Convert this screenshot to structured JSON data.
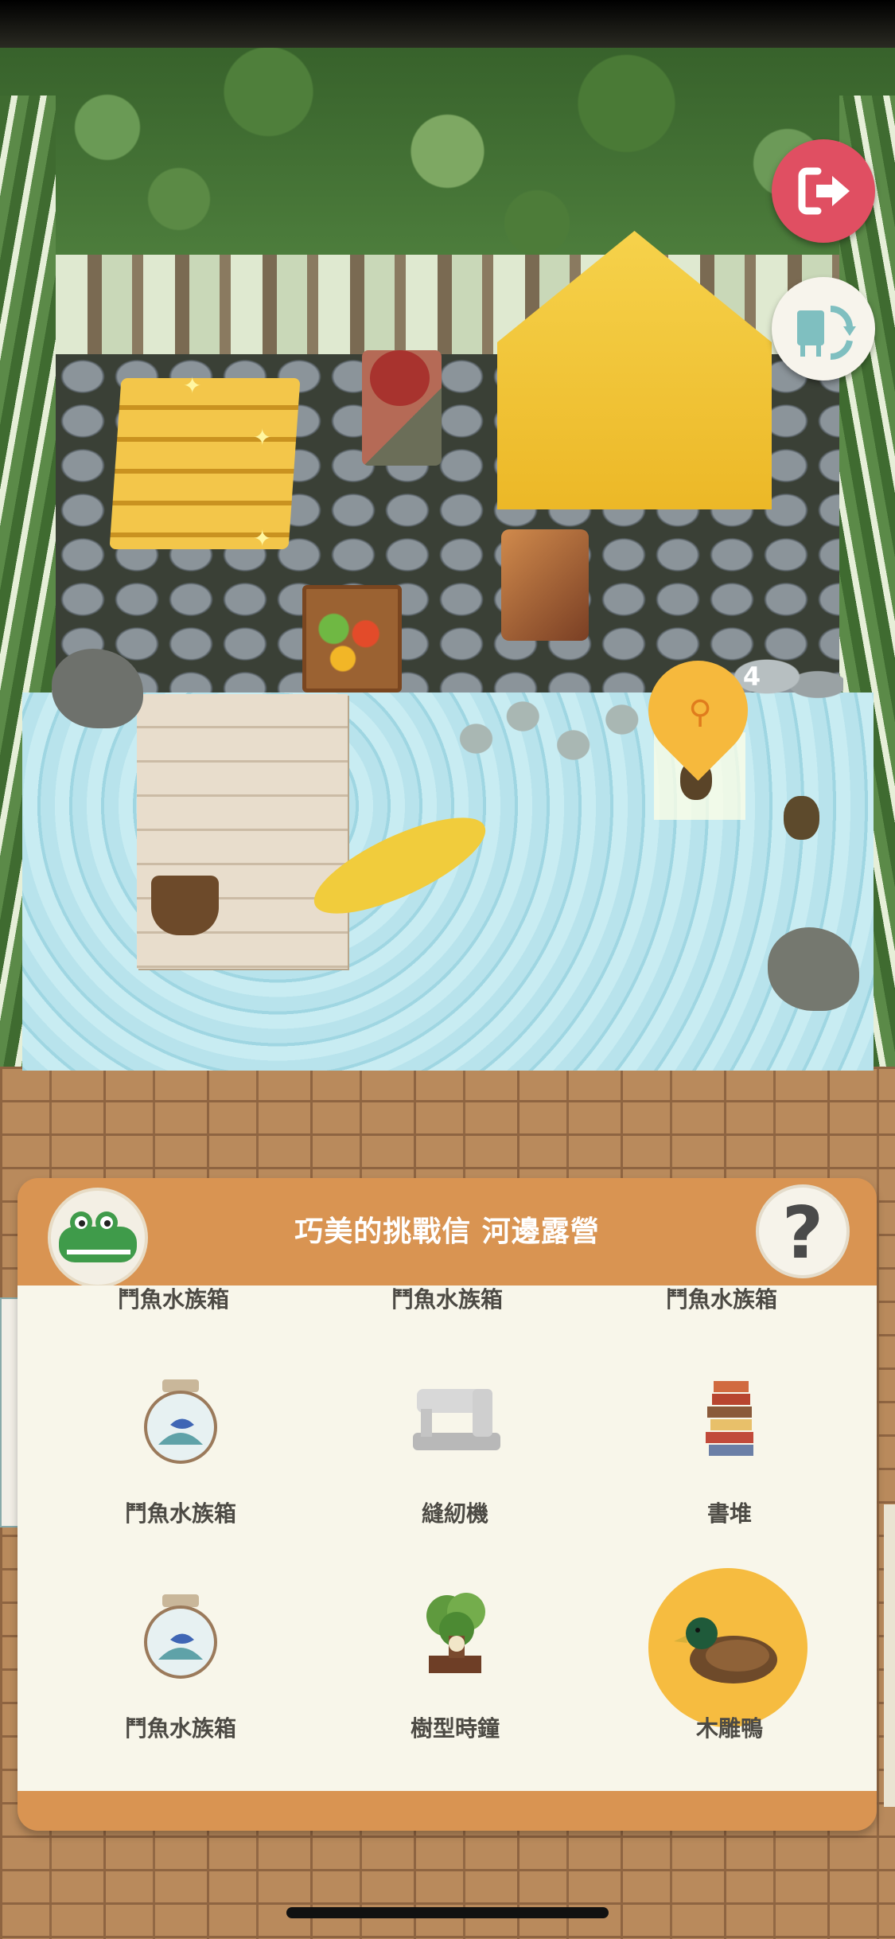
{
  "header": {
    "title": "巧美的挑戰信 河邊露營"
  },
  "room": {
    "marker_count": "4"
  },
  "buttons": {
    "exit_icon": "exit-door-icon",
    "rotate_icon": "rotate-furniture-icon",
    "help_label": "?"
  },
  "grid": {
    "top_row_labels": [
      "鬥魚水族箱",
      "鬥魚水族箱",
      "鬥魚水族箱"
    ],
    "items": [
      {
        "label": "鬥魚水族箱",
        "icon": "betta-aquarium-icon"
      },
      {
        "label": "縫紉機",
        "icon": "sewing-machine-icon"
      },
      {
        "label": "書堆",
        "icon": "book-stack-icon"
      },
      {
        "label": "鬥魚水族箱",
        "icon": "betta-aquarium-icon"
      },
      {
        "label": "樹型時鐘",
        "icon": "tree-clock-icon"
      },
      {
        "label": "木雕鴨",
        "icon": "wooden-duck-icon",
        "selected": true
      }
    ]
  },
  "colors": {
    "accent": "#f6bc40",
    "panel": "#d99452",
    "exit": "#e04f62"
  }
}
